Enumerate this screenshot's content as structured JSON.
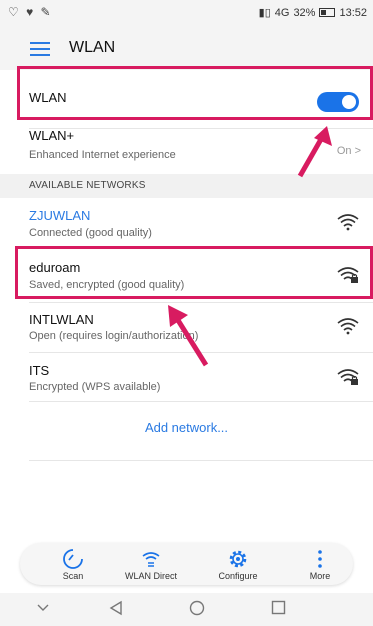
{
  "status_bar": {
    "left_icons": "♡ ♥ ✎",
    "right_text": "32%",
    "time": "13:52",
    "network": "4G"
  },
  "header": {
    "title": "WLAN"
  },
  "wlan_toggle": {
    "label": "WLAN",
    "state": "on"
  },
  "wlan_plus": {
    "title": "WLAN+",
    "subtitle": "Enhanced Internet experience",
    "value": "On"
  },
  "section": {
    "title": "AVAILABLE NETWORKS"
  },
  "networks": [
    {
      "name": "ZJUWLAN",
      "status": "Connected (good quality)",
      "icon": "wifi-icon",
      "secured": false
    },
    {
      "name": "eduroam",
      "status": "Saved, encrypted (good quality)",
      "icon": "wifi-lock-icon",
      "secured": true
    },
    {
      "name": "INTLWLAN",
      "status": "Open (requires login/authorization)",
      "icon": "wifi-icon",
      "secured": false
    },
    {
      "name": "ITS",
      "status": "Encrypted (WPS available)",
      "icon": "wifi-lock-icon",
      "secured": true
    }
  ],
  "add_network": "Add network...",
  "bottom_actions": [
    {
      "label": "Scan",
      "icon": "scan-icon"
    },
    {
      "label": "WLAN Direct",
      "icon": "wlan-direct-icon"
    },
    {
      "label": "Configure",
      "icon": "gear-icon"
    },
    {
      "label": "More",
      "icon": "more-icon"
    }
  ],
  "colors": {
    "accent": "#1a73e8",
    "highlight": "#d81b60"
  }
}
